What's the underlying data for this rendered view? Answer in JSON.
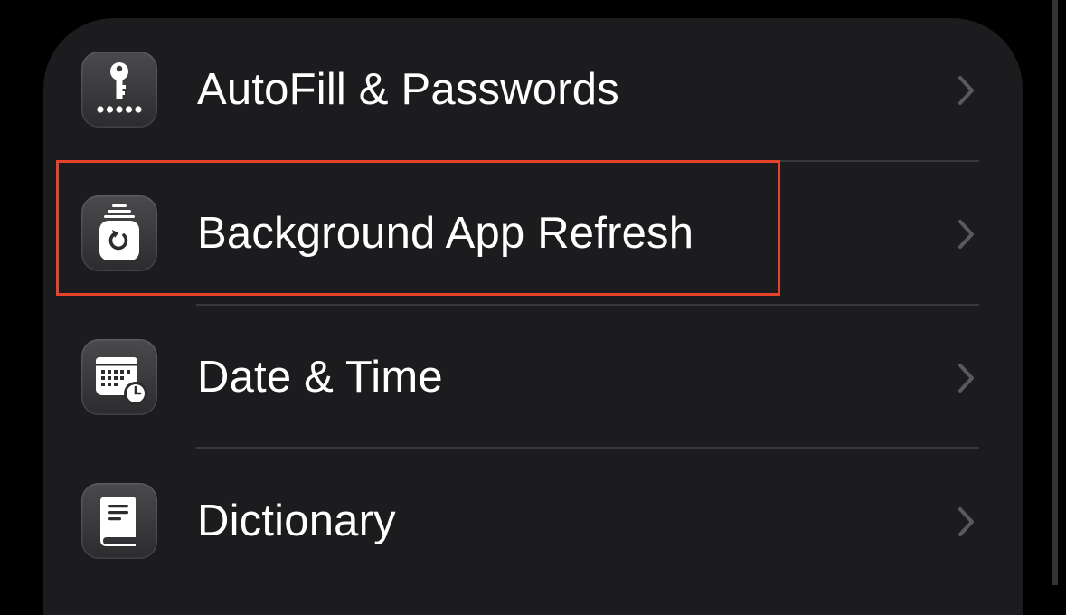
{
  "settings_list": {
    "items": [
      {
        "label": "AutoFill & Passwords",
        "icon": "key-dots-icon"
      },
      {
        "label": "Background App Refresh",
        "icon": "app-refresh-icon"
      },
      {
        "label": "Date & Time",
        "icon": "calendar-clock-icon"
      },
      {
        "label": "Dictionary",
        "icon": "book-icon"
      }
    ]
  },
  "annotation": {
    "highlight_color": "#e5432c"
  },
  "colors": {
    "background": "#000000",
    "card": "#1c1c1e",
    "separator": "#38383a",
    "chevron": "#5a5a5e",
    "text": "#ffffff"
  }
}
